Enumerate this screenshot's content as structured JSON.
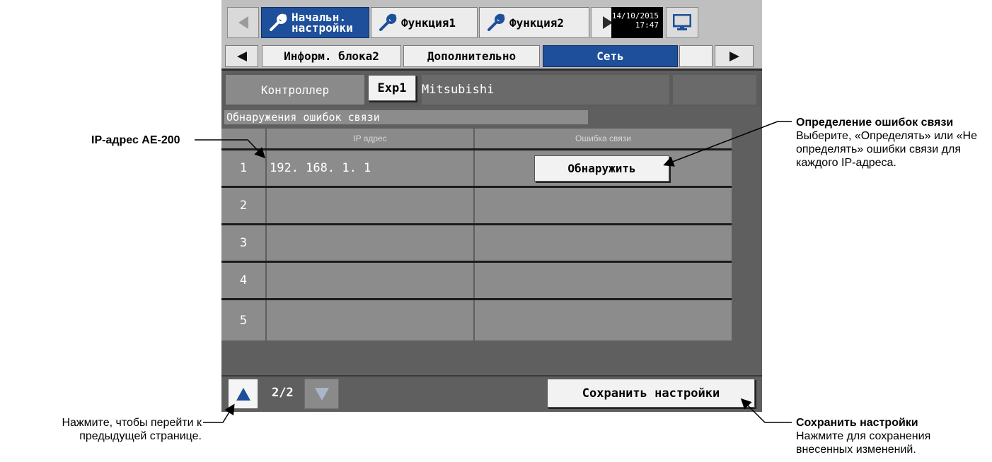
{
  "topbar": {
    "tabs": [
      {
        "label": "Начальн.\nнастройки",
        "active": true,
        "icon": "wrench-icon"
      },
      {
        "label": "Функция1",
        "active": false,
        "icon": "wrench-icon"
      },
      {
        "label": "Функция2",
        "active": false,
        "icon": "wrench-icon"
      }
    ],
    "date": "14/10/2015",
    "time": "17:47"
  },
  "subtabs": [
    "Информ. блока2",
    "Дополнительно",
    "Сеть"
  ],
  "controller": {
    "label": "Контроллер",
    "button": "Exp1",
    "name": "Mitsubishi"
  },
  "section_title": "Обнаружения ошибок связи",
  "table": {
    "headers": [
      "IP адрес",
      "Ошибка связи"
    ],
    "rows": [
      {
        "num": "1",
        "ip": "192. 168. 1. 1",
        "action": "Обнаружить"
      },
      {
        "num": "2",
        "ip": "",
        "action": ""
      },
      {
        "num": "3",
        "ip": "",
        "action": ""
      },
      {
        "num": "4",
        "ip": "",
        "action": ""
      },
      {
        "num": "5",
        "ip": "",
        "action": ""
      }
    ]
  },
  "pager": {
    "page": "2/2"
  },
  "save_label": "Сохранить настройки",
  "annotations": {
    "ip_label": "IP-адрес AE-200",
    "err_title": "Определение ошибок связи",
    "err_text": "Выберите, «Определять» или «Не определять» ошибки связи для каждого IP-адреса.",
    "prev_text": "Нажмите, чтобы перейти к предыдущей странице.",
    "save_title": "Сохранить настройки",
    "save_text": "Нажмите для сохранения внесенных изменений."
  },
  "colors": {
    "accent": "#1e4f9a",
    "panel": "#5f5f5f",
    "cell": "#8c8c8c"
  }
}
